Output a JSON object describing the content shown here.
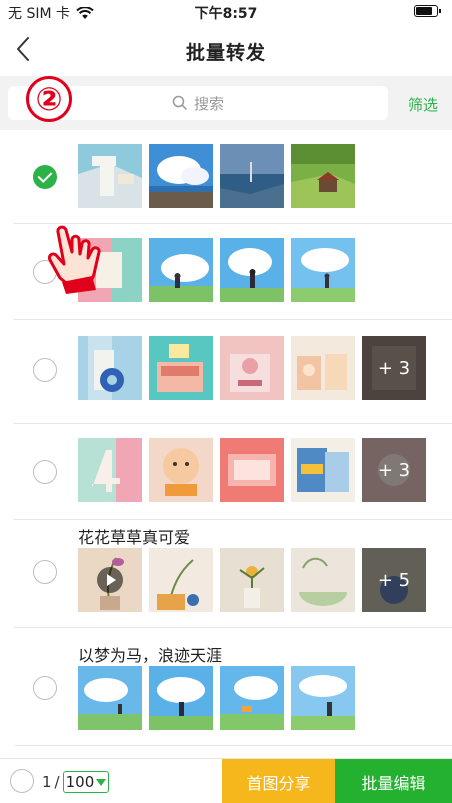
{
  "status_bar": {
    "carrier": "无 SIM 卡",
    "time": "下午8:57"
  },
  "nav": {
    "title": "批量转发"
  },
  "search": {
    "placeholder": "搜索",
    "filter_label": "筛选"
  },
  "step_marker": "②",
  "rows": [
    {
      "caption": "",
      "selected": true,
      "more": ""
    },
    {
      "caption": "",
      "selected": false,
      "more": ""
    },
    {
      "caption": "",
      "selected": false,
      "more": "+ 3"
    },
    {
      "caption": "",
      "selected": false,
      "more": "+ 3"
    },
    {
      "caption": "花花草草真可爱",
      "selected": false,
      "more": "+ 5"
    },
    {
      "caption": "以梦为马，浪迹天涯",
      "selected": false,
      "more": ""
    }
  ],
  "bottom_bar": {
    "page_current": "1",
    "page_separator": "/",
    "page_size": "100",
    "first_image_share": "首图分享",
    "batch_edit": "批量编辑"
  },
  "colors": {
    "accent_green": "#2db24a",
    "share_yellow": "#f6b71c",
    "edit_green": "#23b12f",
    "marker_red": "#e0001b"
  }
}
